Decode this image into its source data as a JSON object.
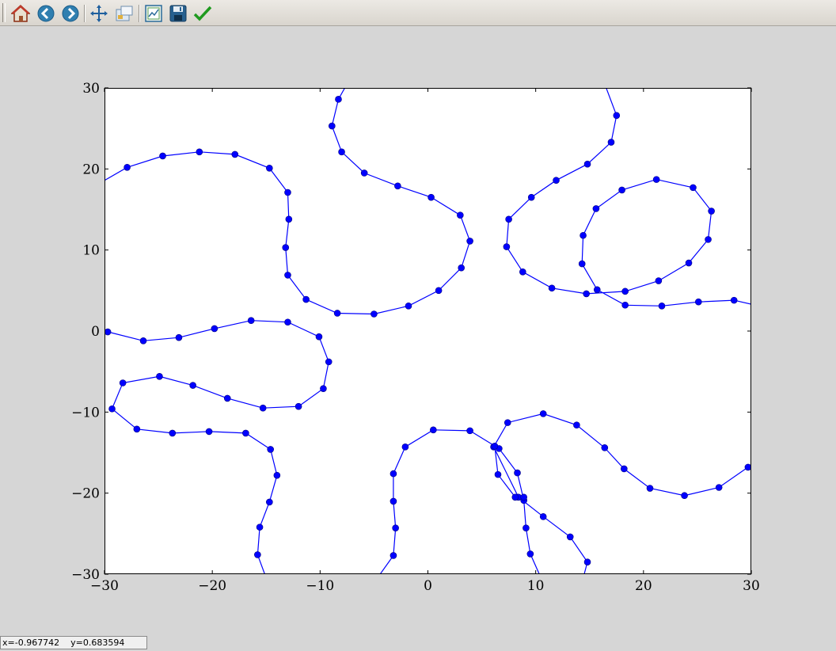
{
  "toolbar": {
    "buttons": [
      {
        "name": "home-button",
        "icon": "home-icon"
      },
      {
        "name": "back-button",
        "icon": "back-arrow-icon"
      },
      {
        "name": "forward-button",
        "icon": "forward-arrow-icon"
      },
      {
        "name": "pan-button",
        "icon": "pan-move-icon"
      },
      {
        "name": "zoom-button",
        "icon": "zoom-rect-icon"
      },
      {
        "name": "subplots-button",
        "icon": "subplots-config-icon"
      },
      {
        "name": "save-button",
        "icon": "save-disk-icon"
      },
      {
        "name": "apply-button",
        "icon": "checkmark-icon"
      }
    ]
  },
  "status": {
    "text": "x=-0.967742    y=0.683594"
  },
  "colors": {
    "line": "#0000ff",
    "marker": "#0000ff",
    "marker_edge": "#000080",
    "figure_bg": "#d6d6d6",
    "axes_bg": "#ffffff"
  },
  "chart_data": {
    "type": "line",
    "marker": "circle",
    "xlim": [
      -30,
      30
    ],
    "ylim": [
      -30,
      30
    ],
    "xticks": [
      -30,
      -20,
      -10,
      0,
      10,
      20,
      30
    ],
    "yticks": [
      -30,
      -20,
      -10,
      0,
      10,
      20,
      30
    ],
    "xtick_labels": [
      "−30",
      "−20",
      "−10",
      "0",
      "10",
      "20",
      "30"
    ],
    "ytick_labels": [
      "−30",
      "−20",
      "−10",
      "0",
      "10",
      "20",
      "30"
    ],
    "grid": false,
    "series": [
      {
        "x": [
          -30.5,
          -27.9,
          -24.6,
          -21.2,
          -17.9,
          -14.7,
          -13.0,
          -12.9,
          -13.2,
          -13.0,
          -11.3,
          -8.4,
          -5.0,
          -1.8,
          1.0,
          3.1,
          3.9,
          3.0,
          0.3,
          -2.8,
          -5.9,
          -8.0,
          -8.9,
          -8.3,
          -7.5
        ],
        "y": [
          18.2,
          20.2,
          21.6,
          22.1,
          21.8,
          20.1,
          17.1,
          13.8,
          10.3,
          6.9,
          3.9,
          2.2,
          2.1,
          3.1,
          5.0,
          7.8,
          11.1,
          14.3,
          16.5,
          17.9,
          19.5,
          22.1,
          25.3,
          28.6,
          30.5
        ]
      },
      {
        "x": [
          -29.7,
          -26.4,
          -23.1,
          -19.8,
          -16.4,
          -13.0,
          -10.1,
          -9.2,
          -9.7,
          -12.0,
          -15.3,
          -18.6,
          -21.8,
          -24.9,
          -28.3,
          -29.3,
          -27.0,
          -23.7,
          -20.3,
          -16.9,
          -14.6,
          -14.0,
          -14.7,
          -15.6,
          -15.8,
          -15.0
        ],
        "y": [
          -0.1,
          -1.2,
          -0.8,
          0.3,
          1.3,
          1.1,
          -0.7,
          -3.8,
          -7.1,
          -9.3,
          -9.5,
          -8.3,
          -6.7,
          -5.6,
          -6.4,
          -9.6,
          -12.1,
          -12.6,
          -12.4,
          -12.6,
          -14.6,
          -17.8,
          -21.1,
          -24.2,
          -27.6,
          -30.5
        ]
      },
      {
        "x": [
          -4.7,
          -3.2,
          -3.0,
          -3.2,
          -3.2,
          -2.1,
          0.5,
          3.9,
          6.6,
          8.3,
          8.9,
          9.1,
          9.5,
          10.5
        ],
        "y": [
          -30.5,
          -27.7,
          -24.3,
          -21.0,
          -17.6,
          -14.3,
          -12.2,
          -12.3,
          -14.5,
          -17.5,
          -20.9,
          -24.3,
          -27.5,
          -30.5
        ]
      },
      {
        "x": [
          14.4,
          14.8,
          13.2,
          10.7,
          8.4,
          6.1,
          7.4,
          10.7,
          13.8,
          16.4,
          18.2,
          20.6,
          23.8,
          27.0,
          29.7,
          31.0
        ],
        "y": [
          -30.5,
          -28.5,
          -25.4,
          -22.9,
          -20.5,
          -14.3,
          -11.3,
          -10.2,
          -11.6,
          -14.4,
          -17.0,
          -19.4,
          -20.3,
          -19.3,
          -16.8,
          -15.3
        ]
      },
      {
        "x": [
          6.2,
          6.5,
          8.1,
          8.9
        ],
        "y": [
          -14.2,
          -17.7,
          -20.5,
          -20.5
        ]
      },
      {
        "x": [
          16.4,
          17.5,
          17.0,
          14.8,
          11.9,
          9.6,
          7.5,
          7.3,
          8.8,
          11.5,
          14.7,
          18.3,
          21.4,
          24.2,
          26.0,
          26.3,
          24.6,
          21.2,
          18.0,
          15.6,
          14.4,
          14.3,
          15.7,
          18.3,
          21.7,
          25.1,
          28.4,
          31.0
        ],
        "y": [
          30.5,
          26.6,
          23.3,
          20.6,
          18.6,
          16.5,
          13.8,
          10.4,
          7.3,
          5.3,
          4.6,
          4.9,
          6.2,
          8.4,
          11.3,
          14.8,
          17.7,
          18.7,
          17.4,
          15.1,
          11.8,
          8.3,
          5.1,
          3.2,
          3.1,
          3.6,
          3.8,
          3.0
        ]
      }
    ]
  }
}
